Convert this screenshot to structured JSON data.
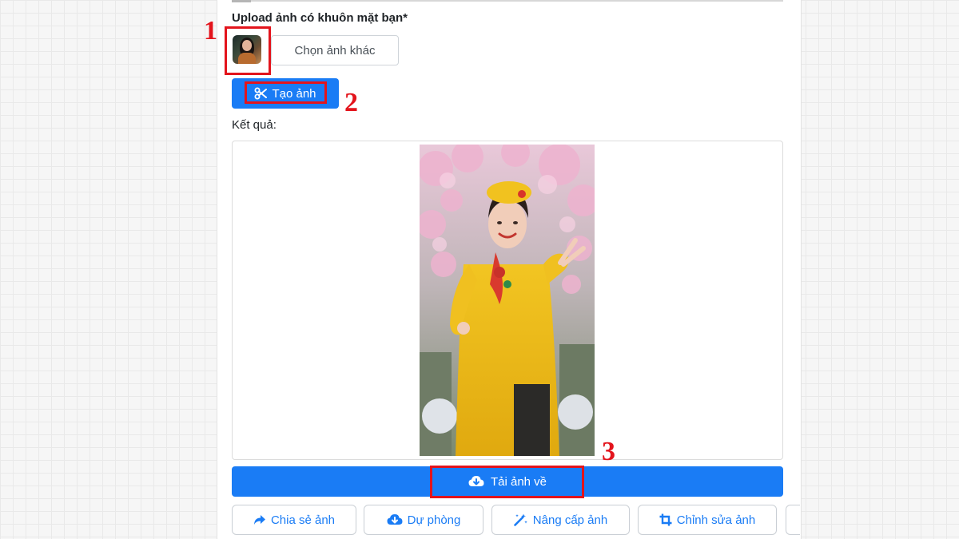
{
  "form": {
    "upload_label": "Upload ảnh có khuôn mặt bạn*",
    "choose_other_label": "Chọn ảnh khác",
    "create_label": "Tạo ảnh",
    "result_label": "Kết quả:"
  },
  "actions": {
    "download_label": "Tải ảnh về",
    "share_label": "Chia sẻ ảnh",
    "backup_label": "Dự phòng",
    "upgrade_label": "Nâng cấp ảnh",
    "edit_label": "Chỉnh sửa ảnh"
  },
  "annotations": {
    "step1": "1",
    "step2": "2",
    "step3": "3"
  },
  "colors": {
    "primary": "#1a7cf5",
    "annotation_red": "#e3141c"
  },
  "icons": [
    "scissors-icon",
    "cloud-download-icon",
    "share-icon",
    "magic-wand-icon",
    "crop-icon"
  ]
}
